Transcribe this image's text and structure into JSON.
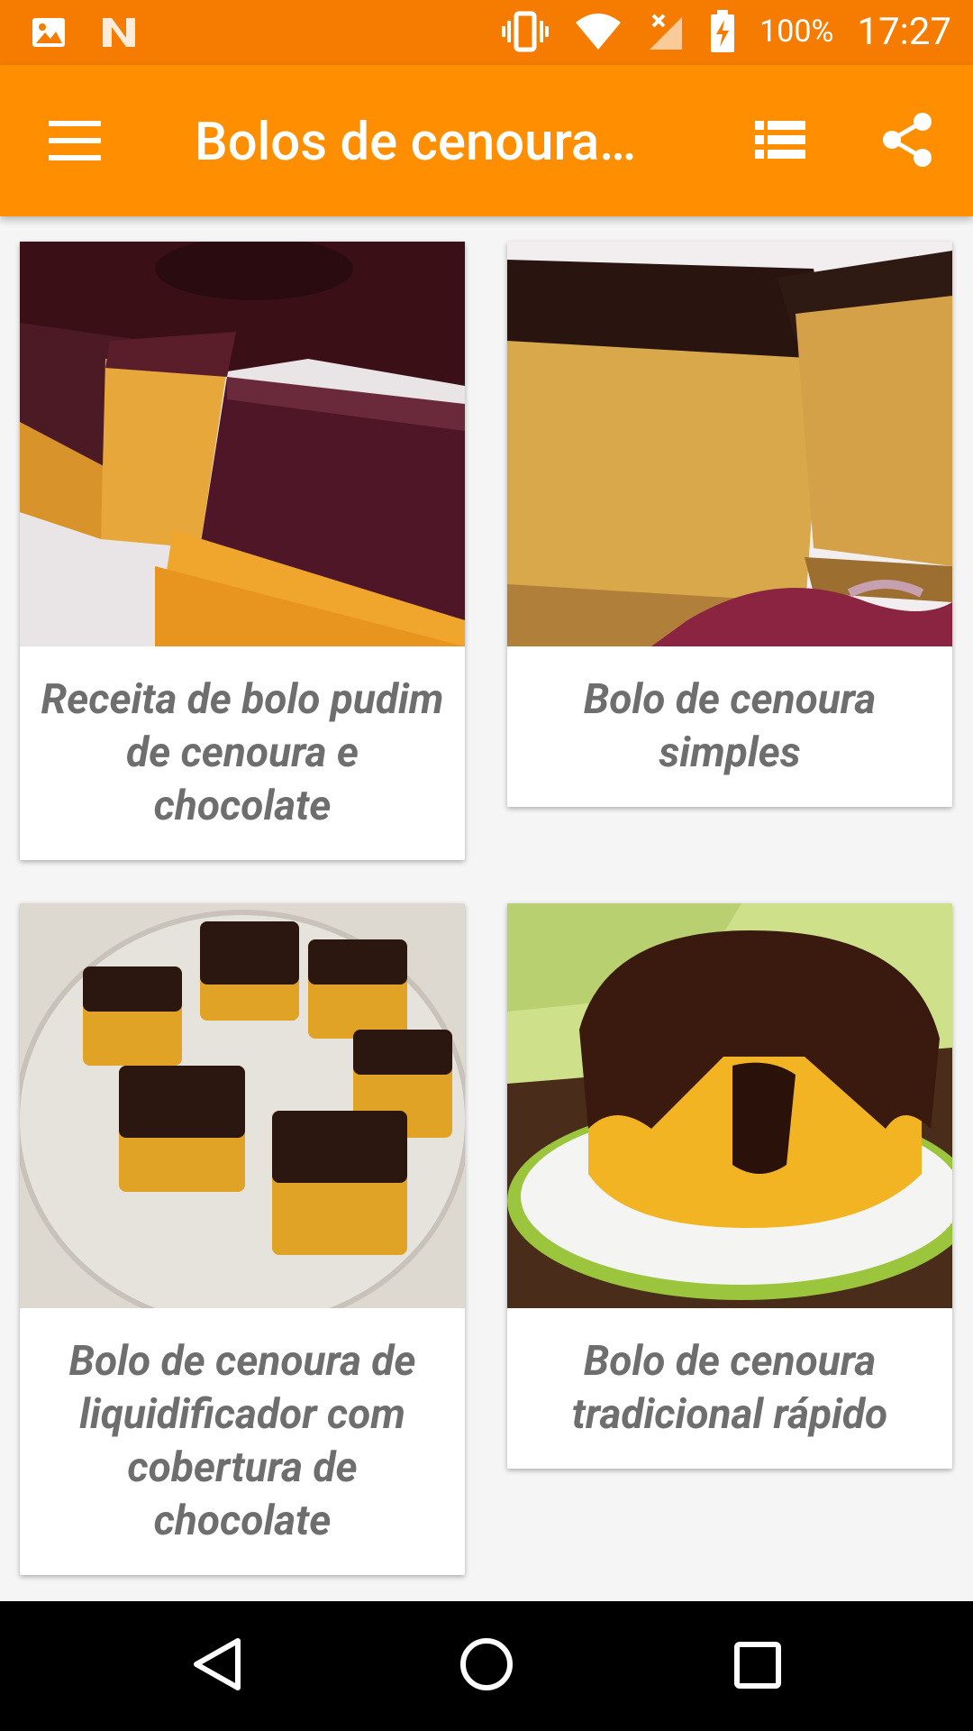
{
  "status": {
    "battery": "100%",
    "time": "17:27"
  },
  "app_bar": {
    "title": "Bolos de cenoura…"
  },
  "recipes": [
    {
      "title": "Receita de bolo pudim de cenoura e chocolate"
    },
    {
      "title": "Bolo de cenoura simples"
    },
    {
      "title": "Bolo de cenoura de liquidificador com cobertura de chocolate"
    },
    {
      "title": "Bolo de cenoura tradicional rápido"
    }
  ],
  "colors": {
    "status_bar": "#f57c00",
    "app_bar": "#ff8f00",
    "card_text": "#6e6e6e"
  }
}
